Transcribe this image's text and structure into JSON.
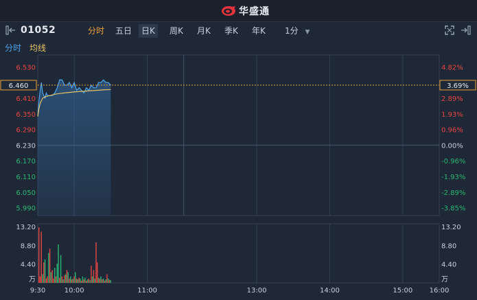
{
  "app": {
    "brand": "华盛通"
  },
  "header": {
    "stock_code": "01052"
  },
  "tabs": [
    {
      "label": "分时",
      "state": "active"
    },
    {
      "label": "五日",
      "state": "normal"
    },
    {
      "label": "日K",
      "state": "selected"
    },
    {
      "label": "周K",
      "state": "normal"
    },
    {
      "label": "月K",
      "state": "normal"
    },
    {
      "label": "季K",
      "state": "normal"
    },
    {
      "label": "年K",
      "state": "normal"
    },
    {
      "label": "1分",
      "state": "dropdown"
    }
  ],
  "legend": {
    "price": "分时",
    "avg": "均线"
  },
  "colors": {
    "up": "#e84545",
    "down": "#2bb673",
    "price_line": "#4ea6ec",
    "avg_line": "#e8c264",
    "accent": "#f0a23c",
    "grid": "#344052"
  },
  "icons": [
    "collapse-left-icon",
    "expand-icon",
    "fullscreen-icon",
    "collapse-right-icon",
    "chevron-down-icon"
  ],
  "chart_data": {
    "type": "line",
    "price_axis_labels": [
      "6.530",
      "6.460",
      "6.410",
      "6.350",
      "6.290",
      "6.230",
      "6.170",
      "6.110",
      "6.050",
      "5.990"
    ],
    "price_axis_values": [
      6.53,
      6.47,
      6.41,
      6.35,
      6.29,
      6.23,
      6.17,
      6.11,
      6.05,
      5.99
    ],
    "pct_axis_labels": [
      "4.82%",
      "3.69%",
      "2.89%",
      "1.93%",
      "0.96%",
      "0.00%",
      "-0.96%",
      "-1.93%",
      "-2.89%",
      "-3.85%"
    ],
    "last_price_label": "6.460",
    "last_pct_label": "3.69%",
    "last_price": 6.46,
    "prev_close": 6.23,
    "ylim": [
      5.96,
      6.56
    ],
    "time_labels": [
      "9:30",
      "10:00",
      "11:00",
      "13:00",
      "14:00",
      "15:00",
      "16:00"
    ],
    "x_minutes_total": 330,
    "series": [
      {
        "name": "分时",
        "x": [
          0,
          1,
          2,
          3,
          4,
          5,
          6,
          7,
          8,
          10,
          12,
          14,
          16,
          18,
          20,
          22,
          24,
          26,
          28,
          30,
          32,
          34,
          36,
          38,
          40,
          42,
          44,
          46,
          48,
          50,
          52,
          54,
          56,
          58,
          60
        ],
        "values": [
          6.34,
          6.4,
          6.44,
          6.47,
          6.43,
          6.42,
          6.41,
          6.43,
          6.42,
          6.42,
          6.42,
          6.43,
          6.45,
          6.48,
          6.48,
          6.46,
          6.46,
          6.47,
          6.45,
          6.47,
          6.44,
          6.45,
          6.44,
          6.43,
          6.45,
          6.44,
          6.46,
          6.45,
          6.45,
          6.47,
          6.47,
          6.48,
          6.47,
          6.47,
          6.46
        ]
      },
      {
        "name": "均线",
        "x": [
          0,
          1,
          2,
          3,
          4,
          6,
          8,
          10,
          14,
          18,
          22,
          26,
          30,
          36,
          42,
          48,
          54,
          60
        ],
        "values": [
          6.34,
          6.37,
          6.39,
          6.4,
          6.41,
          6.415,
          6.418,
          6.42,
          6.425,
          6.428,
          6.43,
          6.432,
          6.434,
          6.436,
          6.438,
          6.44,
          6.442,
          6.443
        ]
      }
    ],
    "volume": {
      "axis_labels": [
        "13.20",
        "8.80",
        "4.40",
        "万"
      ],
      "ylim": [
        0,
        13.2
      ],
      "x": [
        1,
        2,
        3,
        4,
        5,
        6,
        7,
        8,
        9,
        10,
        11,
        12,
        13,
        14,
        15,
        16,
        17,
        18,
        19,
        20,
        21,
        22,
        23,
        24,
        25,
        26,
        27,
        28,
        29,
        30,
        31,
        32,
        33,
        34,
        35,
        36,
        37,
        38,
        39,
        40,
        41,
        42,
        43,
        44,
        45,
        46,
        47,
        48,
        49,
        50,
        51,
        52,
        53,
        54,
        55,
        56,
        57,
        58,
        59,
        60
      ],
      "values": [
        13.0,
        1.5,
        12.0,
        2.0,
        4.8,
        5.5,
        1.0,
        1.5,
        7.0,
        8.0,
        2.5,
        3.0,
        1.0,
        3.5,
        1.5,
        4.5,
        9.0,
        1.2,
        6.5,
        1.5,
        0.8,
        1.8,
        2.0,
        3.0,
        2.5,
        1.0,
        1.5,
        0.8,
        1.0,
        1.5,
        2.5,
        1.0,
        0.8,
        1.2,
        1.0,
        0.5,
        1.5,
        0.8,
        1.2,
        0.5,
        0.8,
        1.0,
        0.6,
        4.0,
        1.5,
        3.0,
        1.0,
        9.5,
        4.8,
        1.2,
        1.0,
        1.5,
        0.8,
        1.0,
        0.5,
        0.8,
        2.0,
        1.0,
        0.7,
        0.6
      ],
      "directions": [
        "up",
        "up",
        "up",
        "down",
        "up",
        "down",
        "up",
        "up",
        "down",
        "up",
        "down",
        "up",
        "up",
        "down",
        "up",
        "down",
        "down",
        "up",
        "down",
        "up",
        "down",
        "up",
        "down",
        "up",
        "down",
        "up",
        "down",
        "up",
        "down",
        "up",
        "down",
        "up",
        "down",
        "up",
        "down",
        "up",
        "down",
        "up",
        "down",
        "up",
        "down",
        "up",
        "down",
        "up",
        "down",
        "up",
        "down",
        "up",
        "up",
        "down",
        "up",
        "down",
        "up",
        "down",
        "up",
        "down",
        "up",
        "down",
        "up",
        "down"
      ]
    }
  }
}
